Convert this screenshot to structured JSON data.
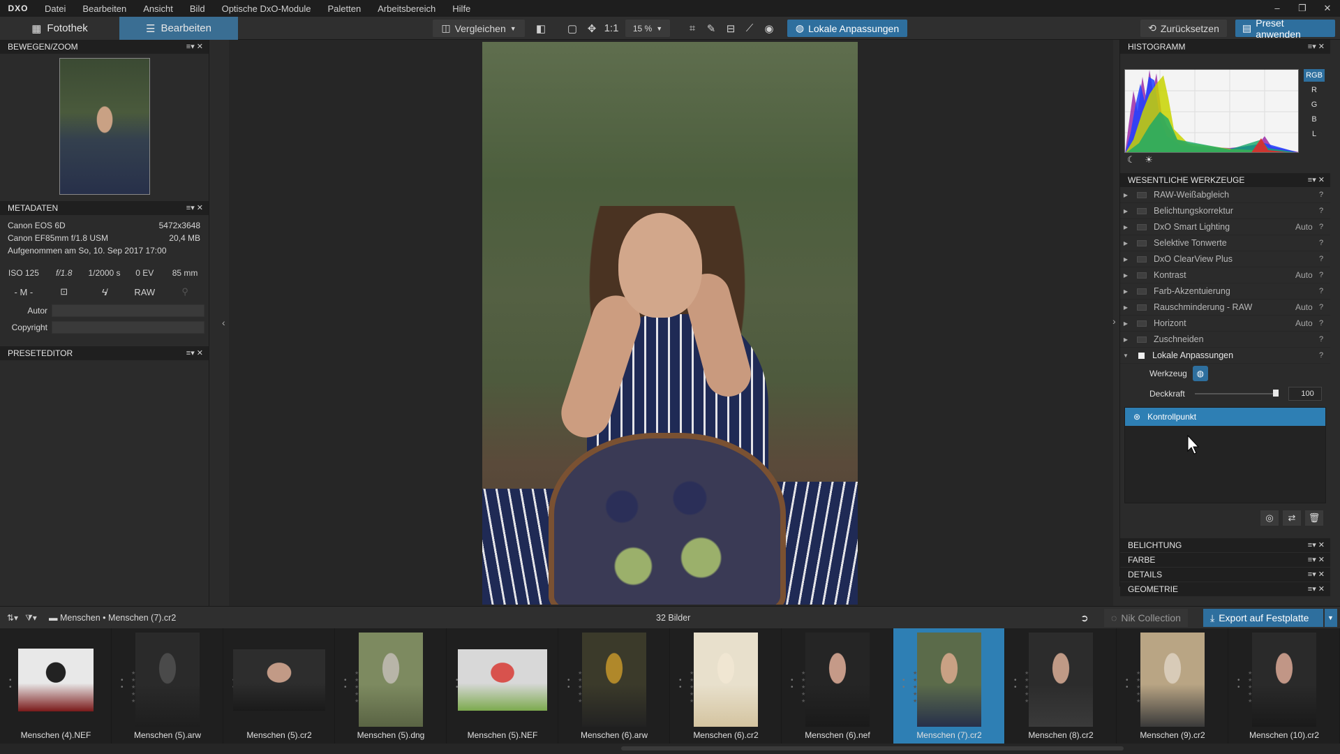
{
  "menu": {
    "logo": "DXO",
    "items": [
      "Datei",
      "Bearbeiten",
      "Ansicht",
      "Bild",
      "Optische DxO-Module",
      "Paletten",
      "Arbeitsbereich",
      "Hilfe"
    ]
  },
  "toolbar": {
    "tab_fotothek": "Fotothek",
    "tab_bearbeiten": "Bearbeiten",
    "compare": "Vergleichen",
    "ratio": "1:1",
    "zoom": "15 %",
    "local_adjust": "Lokale Anpassungen",
    "reset": "Zurücksetzen",
    "preset": "Preset anwenden"
  },
  "left": {
    "move_zoom_title": "BEWEGEN/ZOOM",
    "metadata_title": "METADATEN",
    "camera": "Canon EOS 6D",
    "resolution": "5472x3648",
    "lens": "Canon EF85mm f/1.8 USM",
    "filesize": "20,4 MB",
    "taken": "Aufgenommen am So, 10. Sep 2017 17:00",
    "exif": {
      "iso": "ISO 125",
      "aperture": "f/1.8",
      "shutter": "1/2000 s",
      "ev": "0 EV",
      "focal": "85 mm"
    },
    "mode": "- M -",
    "raw": "RAW",
    "author_label": "Autor",
    "copyright_label": "Copyright",
    "preset_editor_title": "PRESETEDITOR"
  },
  "right": {
    "histogram_title": "HISTOGRAMM",
    "channels": [
      "RGB",
      "R",
      "G",
      "B",
      "L"
    ],
    "tools_title": "WESENTLICHE WERKZEUGE",
    "tools": [
      {
        "label": "RAW-Weißabgleich",
        "auto": ""
      },
      {
        "label": "Belichtungskorrektur",
        "auto": ""
      },
      {
        "label": "DxO Smart Lighting",
        "auto": "Auto"
      },
      {
        "label": "Selektive Tonwerte",
        "auto": ""
      },
      {
        "label": "DxO ClearView Plus",
        "auto": ""
      },
      {
        "label": "Kontrast",
        "auto": "Auto"
      },
      {
        "label": "Farb-Akzentuierung",
        "auto": ""
      },
      {
        "label": "Rauschminderung - RAW",
        "auto": "Auto"
      },
      {
        "label": "Horizont",
        "auto": "Auto"
      },
      {
        "label": "Zuschneiden",
        "auto": ""
      }
    ],
    "local": {
      "label": "Lokale Anpassungen",
      "tool_label": "Werkzeug",
      "opacity_label": "Deckkraft",
      "opacity_value": 100,
      "opacity_text": "100",
      "control_point": "Kontrollpunkt"
    },
    "sections": [
      "BELICHTUNG",
      "FARBE",
      "DETAILS",
      "GEOMETRIE"
    ],
    "help": "?"
  },
  "strip": {
    "folder": "Menschen",
    "file": "Menschen (7).cr2",
    "count": "32 Bilder",
    "nik": "Nik Collection",
    "export": "Export auf Festplatte",
    "thumbs": [
      "Menschen (4).NEF",
      "Menschen (5).arw",
      "Menschen (5).cr2",
      "Menschen (5).dng",
      "Menschen (5).NEF",
      "Menschen (6).arw",
      "Menschen (6).cr2",
      "Menschen (6).nef",
      "Menschen (7).cr2",
      "Menschen (8).cr2",
      "Menschen (9).cr2",
      "Menschen (10).cr2"
    ]
  }
}
